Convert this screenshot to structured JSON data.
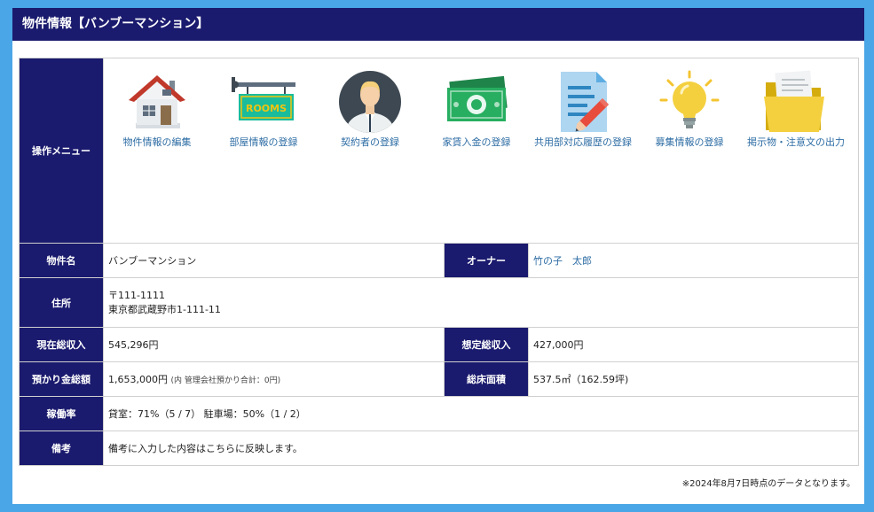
{
  "header": {
    "title": "物件情報【バンブーマンション】"
  },
  "menu": {
    "label": "操作メニュー",
    "items": [
      {
        "label": "物件情報の編集",
        "icon": "house-icon"
      },
      {
        "label": "部屋情報の登録",
        "icon": "rooms-sign-icon"
      },
      {
        "label": "契約者の登録",
        "icon": "person-avatar-icon"
      },
      {
        "label": "家賃入金の登録",
        "icon": "money-icon"
      },
      {
        "label": "共用部対応履歴の登録",
        "icon": "document-pencil-icon"
      },
      {
        "label": "募集情報の登録",
        "icon": "lightbulb-icon"
      },
      {
        "label": "掲示物・注意文の出力",
        "icon": "folder-icon"
      }
    ],
    "rooms_sign_text": "ROOMS"
  },
  "property": {
    "name_label": "物件名",
    "name": "バンブーマンション",
    "owner_label": "オーナー",
    "owner": "竹の子　太郎",
    "address_label": "住所",
    "postal": "〒111-1111",
    "address": "東京都武蔵野市1-111-11",
    "current_rent_label": "現在総収入",
    "current_rent": "545,296円",
    "expected_rent_label": "想定総収入",
    "expected_rent": "427,000円",
    "deposit_label": "預かり金総額",
    "deposit": "1,653,000円",
    "deposit_note": "(内 管理会社預かり合計：0円)",
    "floor_area_label": "総床面積",
    "floor_area": "537.5㎡（162.59坪)",
    "occupancy_label": "稼働率",
    "occupancy": "貸室：71%（5 / 7） 駐車場：50%（1 / 2）",
    "notes_label": "備考",
    "notes": "備考に入力した内容はこちらに反映します。"
  },
  "footnote": "※2024年8月7日時点のデータとなります。",
  "colors": {
    "header_bg": "#1a1a6e",
    "page_bg": "#4aa6e6",
    "link": "#2e6da4"
  }
}
